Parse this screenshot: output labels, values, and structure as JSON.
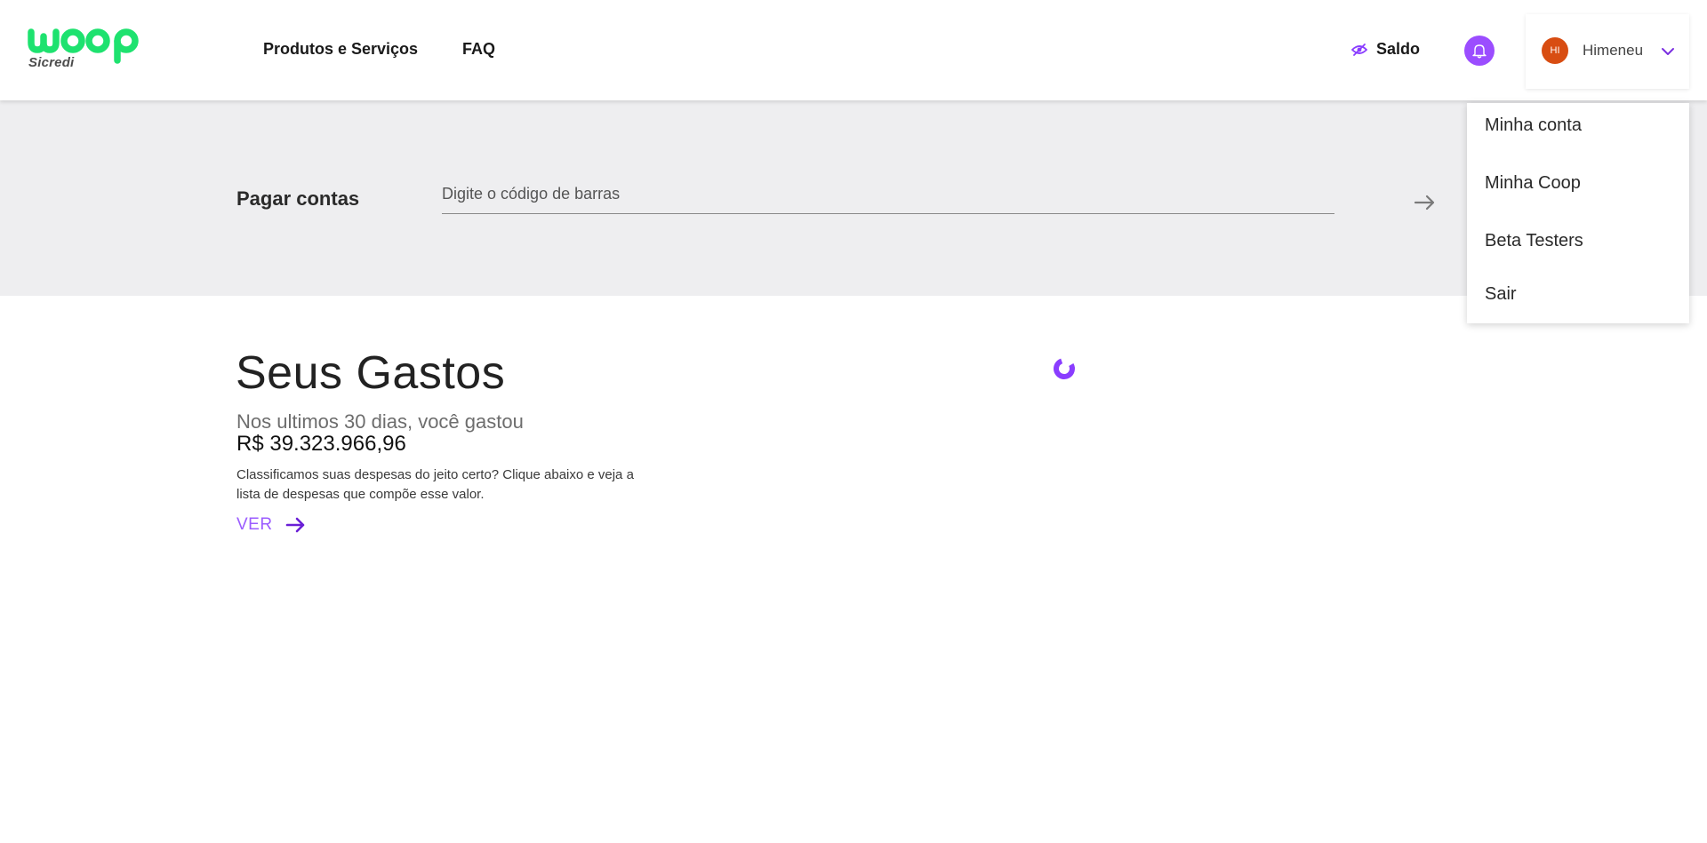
{
  "colors": {
    "brand_green": "#1ee26f",
    "accent_purple": "#9b4dff",
    "avatar_bg": "#d84d12",
    "band_bg": "#eeeef0"
  },
  "header": {
    "logo_word": "woop",
    "logo_sub": "Sicredi",
    "nav": [
      {
        "label": "Produtos e Serviços"
      },
      {
        "label": "FAQ"
      }
    ],
    "saldo_label": "Saldo",
    "saldo_icon": "eye-slash-icon",
    "bell_icon": "bell-icon",
    "user": {
      "initials": "HI",
      "name": "Himeneu",
      "chevron_icon": "chevron-down-icon"
    }
  },
  "user_menu": {
    "items": [
      {
        "label": "Minha conta"
      },
      {
        "label": "Minha Coop"
      },
      {
        "label": "Beta Testers"
      },
      {
        "label": "Sair"
      }
    ]
  },
  "pay": {
    "title": "Pagar contas",
    "input_placeholder": "Digite o código de barras",
    "input_value": "",
    "submit_icon": "arrow-right-icon"
  },
  "spending": {
    "title": "Seus Gastos",
    "lead": "Nos ultimos 30 dias, você gastou",
    "amount": "R$ 39.323.966,96",
    "description": "Classificamos suas despesas do jeito certo? Clique abaixo e veja a lista de despesas que compõe esse valor.",
    "ver_label": "VER",
    "ver_icon": "arrow-right-icon",
    "loading_icon": "spinner-icon"
  }
}
